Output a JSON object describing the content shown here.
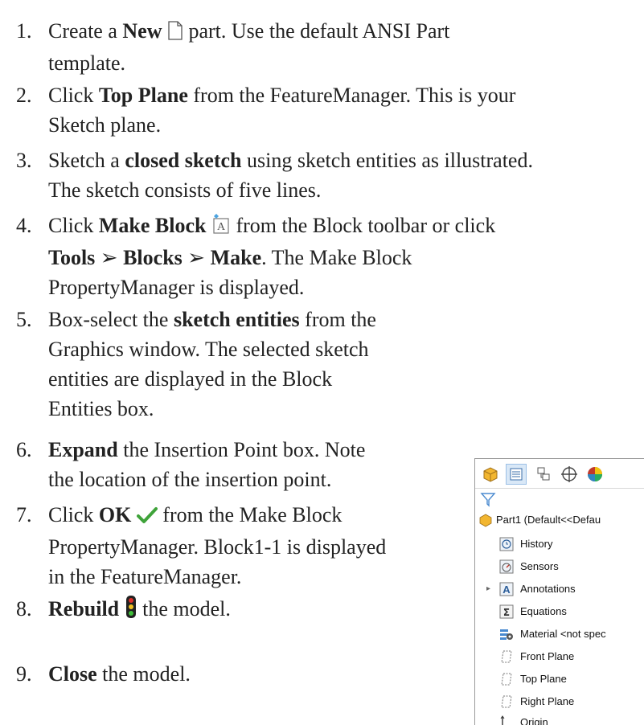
{
  "steps": [
    {
      "num": "1.",
      "parts": [
        {
          "t": "Create a "
        },
        {
          "b": "New"
        },
        {
          "icon": "new-document-icon"
        },
        {
          "t": " part. Use the default ANSI Part"
        }
      ],
      "line2": "template."
    },
    {
      "num": "2.",
      "line1a": "Click ",
      "line1b": "Top Plane",
      "line1c": " from the FeatureManager. This is your",
      "line2": "Sketch plane."
    },
    {
      "num": "3.",
      "line1a": "Sketch a ",
      "line1b": "closed sketch",
      "line1c": " using sketch entities as illustrated.",
      "line2": "The sketch consists of five lines."
    },
    {
      "num": "4.",
      "line1a": "Click ",
      "line1b": "Make Block",
      "line1c": " from the Block toolbar or click",
      "line2a": "Tools",
      "sep": "➢",
      "line2b": "Blocks",
      "line2c": "Make",
      "line2d": ". The Make Block",
      "line3": "PropertyManager is displayed."
    },
    {
      "num": "5.",
      "line1a": "Box-select the ",
      "line1b": "sketch entities",
      "line1c": " from the",
      "line2": "Graphics window. The selected sketch",
      "line3": "entities are displayed in the Block",
      "line4": "Entities box."
    },
    {
      "num": "6.",
      "line1b": "Expand",
      "line1c": " the Insertion Point box. Note",
      "line2": "the location of the insertion point."
    },
    {
      "num": "7.",
      "line1a": "Click ",
      "line1b": "OK",
      "line1c": " from the Make Block",
      "line2": "PropertyManager. Block1-1 is displayed",
      "line3": "in the FeatureManager."
    },
    {
      "num": "8.",
      "line1b": "Rebuild",
      "line1c": " the model."
    },
    {
      "num": "9.",
      "line1b": "Close",
      "line1c": " the model."
    }
  ],
  "feature_manager": {
    "root": "Part1  (Default<<Defau",
    "items": [
      {
        "label": "History",
        "icon": "history-icon"
      },
      {
        "label": "Sensors",
        "icon": "sensors-icon"
      },
      {
        "label": "Annotations",
        "icon": "annotations-icon"
      },
      {
        "label": "Equations",
        "icon": "equations-icon"
      },
      {
        "label": "Material <not spec",
        "icon": "material-icon"
      },
      {
        "label": "Front Plane",
        "icon": "plane-icon"
      },
      {
        "label": "Top Plane",
        "icon": "plane-icon"
      },
      {
        "label": "Right Plane",
        "icon": "plane-icon"
      },
      {
        "label": "Origin",
        "icon": "origin-icon"
      }
    ]
  }
}
